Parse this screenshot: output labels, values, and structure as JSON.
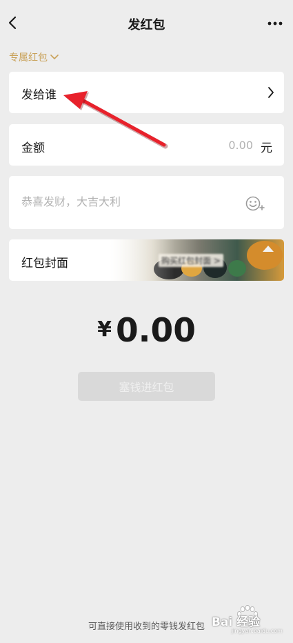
{
  "header": {
    "back_icon": "chevron-left-icon",
    "title": "发红包",
    "more_icon": "more-dots-icon"
  },
  "exclusive_toggle": {
    "label": "专属红包",
    "icon": "chevron-down-icon",
    "color": "#c9a25a"
  },
  "recipient": {
    "label": "发给谁",
    "icon": "chevron-right-icon"
  },
  "amount": {
    "label": "金额",
    "placeholder": "0.00",
    "unit": "元"
  },
  "greeting": {
    "placeholder": "恭喜发财，大吉大利",
    "emoji_icon": "emoji-add-icon"
  },
  "cover": {
    "label": "红包封面",
    "name_blurred": "购买红包封面 >",
    "badge_icon": "arrow-up-badge-icon"
  },
  "total": {
    "currency": "¥",
    "value": "0.00"
  },
  "submit_button": {
    "label": "塞钱进红包",
    "disabled": true
  },
  "footer_note": "可直接使用收到的零钱发红包",
  "watermark": {
    "brand": "Bai 经验",
    "url": "jingyan.baidu.com"
  },
  "colors": {
    "background": "#ededed",
    "card": "#ffffff",
    "accent_gold": "#c9a25a",
    "annotation_arrow": "#e8212b",
    "placeholder_text": "#b2b2b2",
    "disabled_button": "#d9d9d9"
  }
}
